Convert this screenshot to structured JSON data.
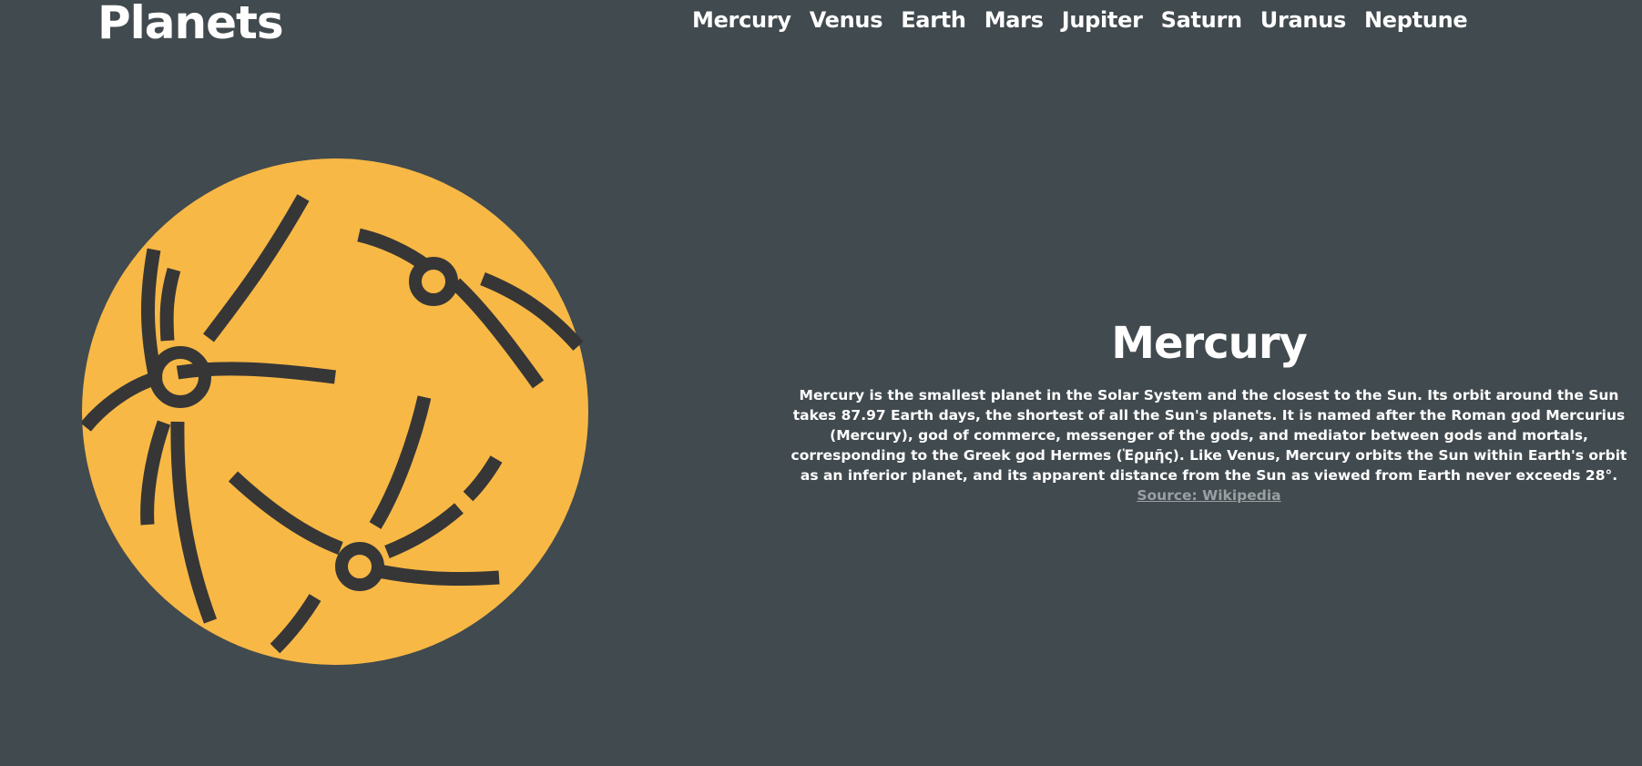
{
  "header": {
    "brand": "Planets",
    "nav": [
      "Mercury",
      "Venus",
      "Earth",
      "Mars",
      "Jupiter",
      "Saturn",
      "Uranus",
      "Neptune"
    ]
  },
  "planet": {
    "icon": "planet-orbits-icon",
    "colors": {
      "planet": "#f8b846",
      "lines": "#363636",
      "background": "#414a4e"
    }
  },
  "info": {
    "title": "Mercury",
    "description": "Mercury is the smallest planet in the Solar System and the closest to the Sun. Its orbit around the Sun takes 87.97 Earth days, the shortest of all the Sun's planets. It is named after the Roman god Mercurius (Mercury), god of commerce, messenger of the gods, and mediator between gods and mortals, corresponding to the Greek god Hermes (Ἑρμῆς). Like Venus, Mercury orbits the Sun within Earth's orbit as an inferior planet, and its apparent distance from the Sun as viewed from Earth never exceeds 28°.",
    "source_label": "Source: Wikipedia"
  }
}
